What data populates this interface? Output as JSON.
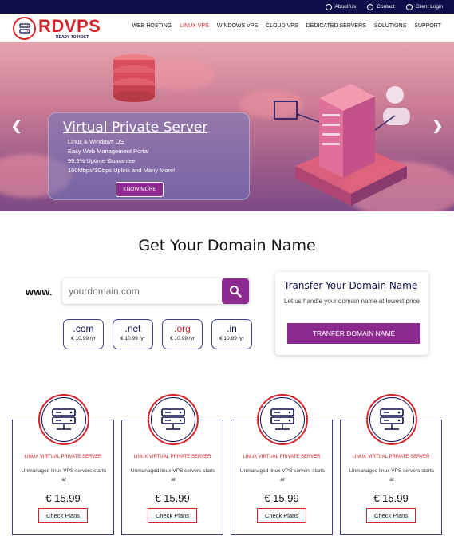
{
  "topbar": {
    "links": [
      {
        "label": "About Us",
        "icon": "about-icon"
      },
      {
        "label": "Contact",
        "icon": "phone-icon"
      },
      {
        "label": "Client Login",
        "icon": "login-icon"
      }
    ]
  },
  "logo": {
    "brand": "RDVPS",
    "tagline": "READY TO HOST"
  },
  "nav": {
    "items": [
      {
        "label": "WEB HOSTING",
        "active": false
      },
      {
        "label": "LINUX VPS",
        "active": true
      },
      {
        "label": "WINDOWS VPS",
        "active": false
      },
      {
        "label": "CLOUD VPS",
        "active": false
      },
      {
        "label": "DEDICATED SERVERS",
        "active": false
      },
      {
        "label": "SOLUTIONS",
        "active": false
      },
      {
        "label": "SUPPORT",
        "active": false
      }
    ]
  },
  "hero": {
    "title": "Virtual Private Server",
    "features": [
      "Linux & Windows OS",
      "Easy Web Management Portal",
      "99.9% Uptime Guarantee",
      "100Mbps/1Gbps Uplink and Many More!"
    ],
    "button": "KNOW MORE",
    "prev_icon": "chevron-left-icon",
    "next_icon": "chevron-right-icon"
  },
  "domain": {
    "title": "Get Your Domain Name",
    "www_label": "www.",
    "search_placeholder": "yourdomain.com",
    "tlds": [
      {
        "ext": ".com",
        "price": "€ 10.99 /yr",
        "highlight": false
      },
      {
        "ext": ".net",
        "price": "€ 10.99 /yr",
        "highlight": false
      },
      {
        "ext": ".org",
        "price": "€ 10.99 /yr",
        "highlight": true
      },
      {
        "ext": ".in",
        "price": "€ 10.99 /yr",
        "highlight": false
      }
    ]
  },
  "transfer": {
    "title": "Transfer Your Domain Name",
    "description": "Let us handle your domain name at lowest price",
    "button": "TRANFER DOMAIN NAME"
  },
  "plans": [
    {
      "name": "LINUX VIRTUAL PRIVATE SERVER",
      "desc": "Unmanaged linux VPS servers starts at",
      "price": "€ 15.99",
      "button": "Check Plans"
    },
    {
      "name": "LINUX VIRTUAL PRIVATE SERVER",
      "desc": "Unmanaged linux VPS servers starts at",
      "price": "€ 15.99",
      "button": "Check Plans"
    },
    {
      "name": "LINUX VIRTUAL PRIVATE SERVER",
      "desc": "Unmanaged linux VPS servers starts at",
      "price": "€ 15.99",
      "button": "Check Plans"
    },
    {
      "name": "LINUX VIRTUAL PRIVATE SERVER",
      "desc": "Unmanaged linux VPS servers starts at",
      "price": "€ 15.99",
      "button": "Check Plans"
    }
  ],
  "colors": {
    "navy": "#0d0f4a",
    "red": "#d6232a",
    "purple": "#8d2a8f"
  }
}
